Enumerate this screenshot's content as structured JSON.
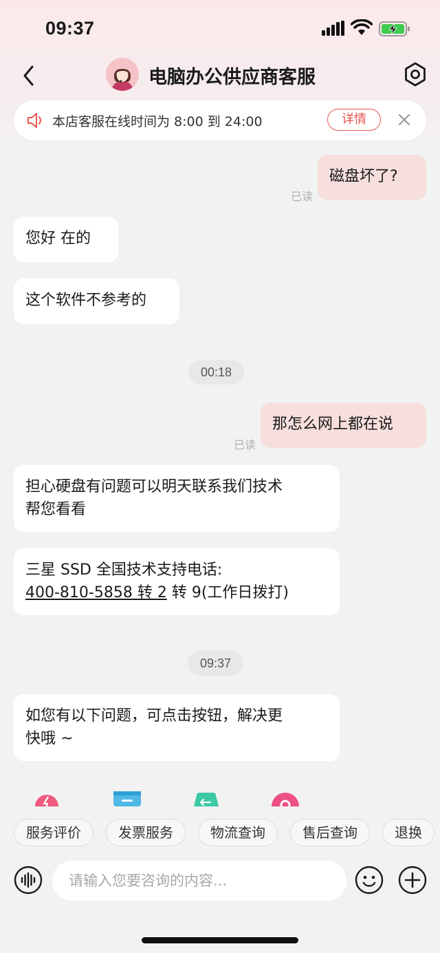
{
  "status_bar": {
    "time": "09:37"
  },
  "nav": {
    "title": "电脑办公供应商客服"
  },
  "notice": {
    "text": "本店客服在线时间为 8:00 到 24:00",
    "detail_label": "详情"
  },
  "messages": [
    {
      "side": "right",
      "text": "磁盘坏了?",
      "read": "已读"
    },
    {
      "side": "left",
      "text": "您好 在的"
    },
    {
      "side": "left",
      "text": "这个软件不参考的"
    },
    {
      "side": "time",
      "text": "00:18"
    },
    {
      "side": "right",
      "text": "那怎么网上都在说",
      "read": "已读"
    },
    {
      "side": "left",
      "line1": "担心硬盘有问题可以明天联系我们技术",
      "line2": "帮您看看"
    },
    {
      "side": "left",
      "line1": "三星 SSD 全国技术支持电话:",
      "phone": "400-810-5858 转 2",
      "suffix": " 转 9(工作日拨打)"
    },
    {
      "side": "time",
      "text": "09:37"
    },
    {
      "side": "left",
      "line1": "如您有以下问题，可点击按钮，解决更",
      "line2": "快哦 ~"
    }
  ],
  "quick_icons": [
    "flash-icon",
    "invoice-icon",
    "return-icon",
    "search-circle-icon"
  ],
  "quick_chips": [
    "服务评价",
    "发票服务",
    "物流查询",
    "售后查询",
    "退换"
  ],
  "input": {
    "placeholder": "请输入您要咨询的内容..."
  },
  "colors": {
    "accent": "#e8534f",
    "right_bubble": "#f6dfdd",
    "left_bubble": "#ffffff",
    "background": "#f2f2f2"
  }
}
